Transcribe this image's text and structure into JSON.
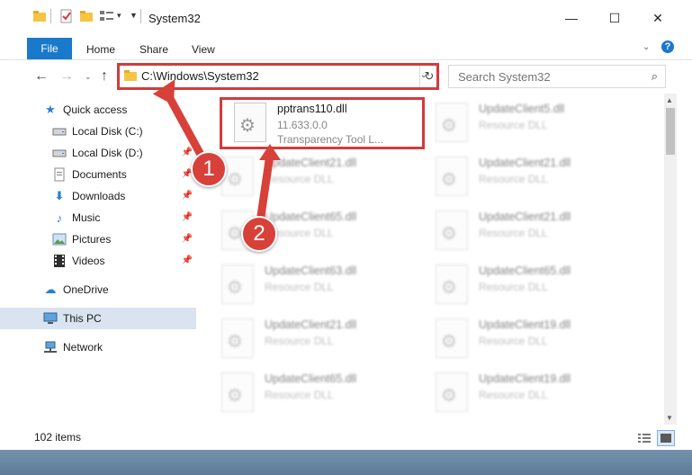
{
  "window": {
    "title": "System32"
  },
  "ribbon": {
    "tabs": [
      "File",
      "Home",
      "Share",
      "View"
    ]
  },
  "address": {
    "path": "C:\\Windows\\System32"
  },
  "search": {
    "placeholder": "Search System32"
  },
  "nav": {
    "items": [
      {
        "label": "Quick access",
        "icon": "star-icon"
      },
      {
        "label": "Local Disk (C:)",
        "icon": "drive-icon"
      },
      {
        "label": "Local Disk (D:)",
        "icon": "drive-icon"
      },
      {
        "label": "Documents",
        "icon": "documents-icon"
      },
      {
        "label": "Downloads",
        "icon": "download-icon"
      },
      {
        "label": "Music",
        "icon": "music-icon"
      },
      {
        "label": "Pictures",
        "icon": "pictures-icon"
      },
      {
        "label": "Videos",
        "icon": "videos-icon"
      },
      {
        "label": "OneDrive",
        "icon": "cloud-icon"
      },
      {
        "label": "This PC",
        "icon": "computer-icon"
      },
      {
        "label": "Network",
        "icon": "network-icon"
      }
    ]
  },
  "files": {
    "highlighted": {
      "name": "pptrans110.dll",
      "version": "11.633.0.0",
      "description": "Transparency Tool L..."
    },
    "left": [
      {
        "name": "UpdateClient21.dll",
        "type": "Resource DLL"
      },
      {
        "name": "UpdateClient65.dll",
        "type": "Resource DLL"
      },
      {
        "name": "UpdateClient63.dll",
        "type": "Resource DLL"
      },
      {
        "name": "UpdateClient21.dll",
        "type": "Resource DLL"
      },
      {
        "name": "UpdateClient65.dll",
        "type": "Resource DLL"
      }
    ],
    "right": [
      {
        "name": "UpdateClient5.dll",
        "type": "Resource DLL"
      },
      {
        "name": "UpdateClient21.dll",
        "type": "Resource DLL"
      },
      {
        "name": "UpdateClient21.dll",
        "type": "Resource DLL"
      },
      {
        "name": "UpdateClient65.dll",
        "type": "Resource DLL"
      },
      {
        "name": "UpdateClient19.dll",
        "type": "Resource DLL"
      },
      {
        "name": "UpdateClient19.dll",
        "type": "Resource DLL"
      }
    ]
  },
  "status": {
    "count": "102 items"
  },
  "annotations": {
    "step1": "1",
    "step2": "2"
  },
  "colors": {
    "accent": "#1979ca",
    "highlight": "#d43b3b",
    "selection": "#d9e4f0"
  }
}
